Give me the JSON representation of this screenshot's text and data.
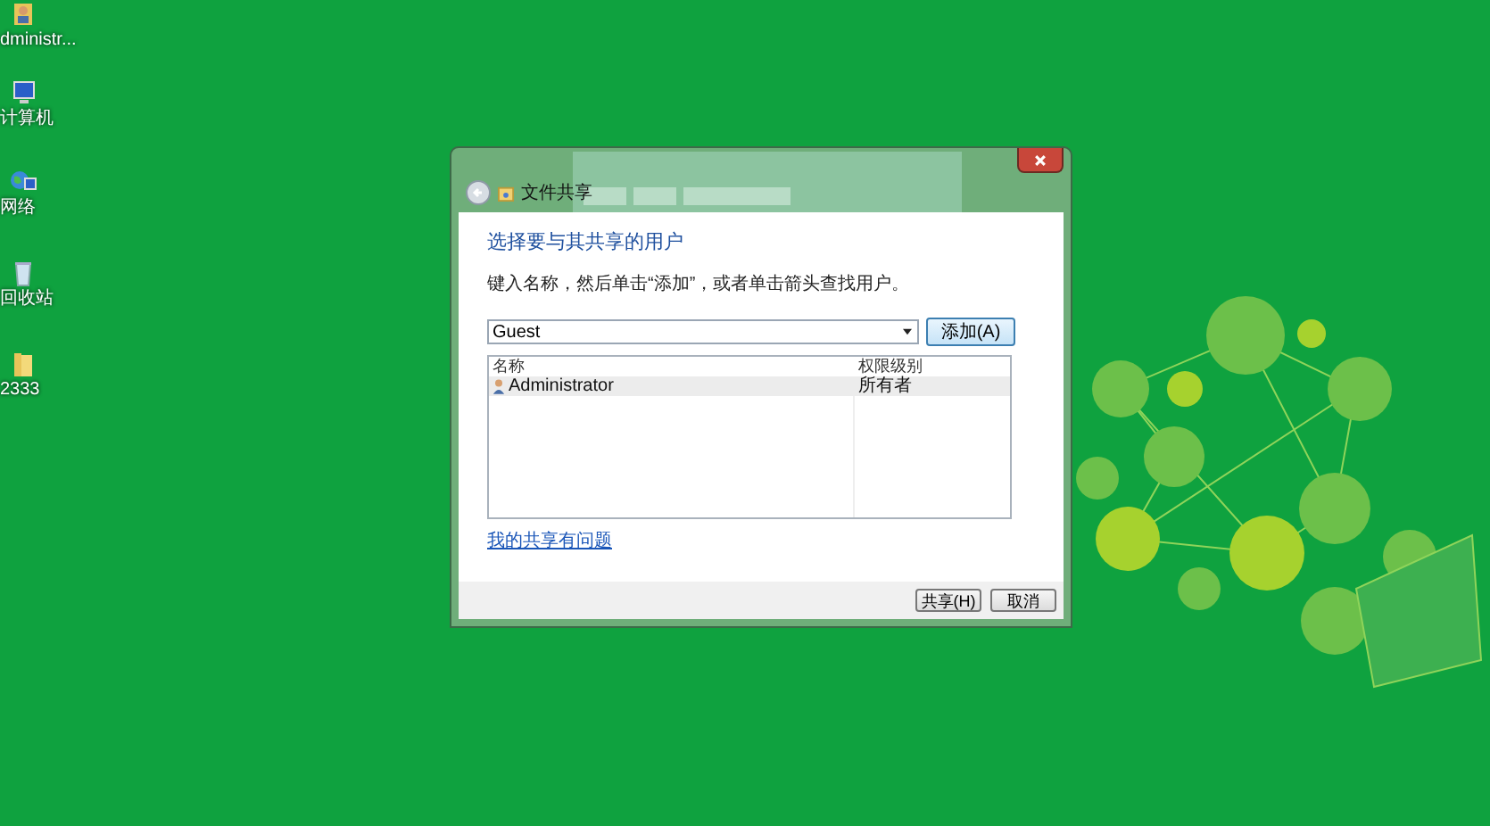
{
  "desktop_icons": [
    {
      "kind": "user",
      "label": "dministr..."
    },
    {
      "kind": "computer",
      "label": "计算机"
    },
    {
      "kind": "network",
      "label": "网络"
    },
    {
      "kind": "recycle",
      "label": "回收站"
    },
    {
      "kind": "folder",
      "label": "2333"
    }
  ],
  "window": {
    "title": "文件共享"
  },
  "heading": "选择要与其共享的用户",
  "instruction": "键入名称，然后单击“添加”，或者单击箭头查找用户。",
  "name_field": {
    "value": "Guest"
  },
  "add_button": "添加(A)",
  "table": {
    "columns": [
      "名称",
      "权限级别"
    ],
    "rows": [
      {
        "name": "Administrator",
        "permission": "所有者"
      }
    ]
  },
  "help_link": "我的共享有问题",
  "buttons": [
    "共享(H)",
    "取消"
  ]
}
